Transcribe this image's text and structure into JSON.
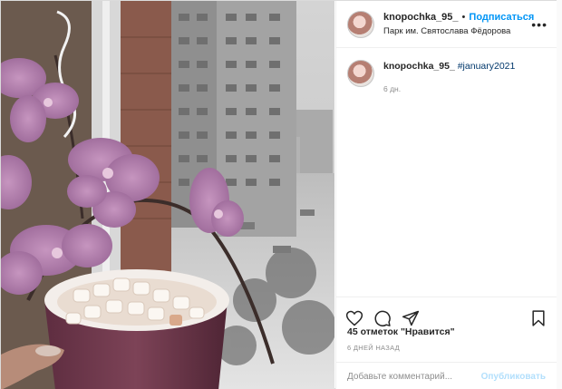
{
  "post": {
    "username": "knopochka_95_",
    "follow_label": "Подписаться",
    "separator": "•",
    "location": "Парк им. Святослава Фёдорова",
    "more_label": "•••"
  },
  "caption": {
    "username": "knopochka_95_",
    "hashtag": "#january2021",
    "age": "6 дн."
  },
  "likes_text": "45 отметок \"Нравится\"",
  "timestamp": "6 ДНЕЙ НАЗАД",
  "comment": {
    "placeholder": "Добавьте комментарий...",
    "publish_label": "Опубликовать"
  },
  "colors": {
    "link_blue": "#0095f6",
    "hashtag": "#00376b",
    "publish_disabled": "#b2dffc"
  },
  "icons": [
    "heart-icon",
    "comment-icon",
    "share-icon",
    "bookmark-icon",
    "more-icon"
  ]
}
